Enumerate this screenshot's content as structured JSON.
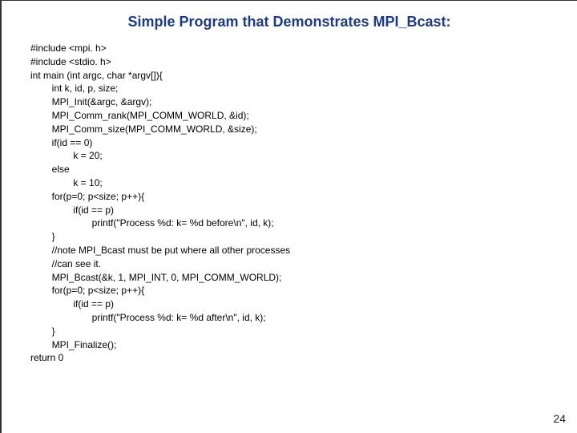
{
  "title": "Simple Program that Demonstrates MPI_Bcast:",
  "code": "#include <mpi. h>\n#include <stdio. h>\nint main (int argc, char *argv[]){\n        int k, id, p, size;\n        MPI_Init(&argc, &argv);\n        MPI_Comm_rank(MPI_COMM_WORLD, &id);\n        MPI_Comm_size(MPI_COMM_WORLD, &size);\n        if(id == 0)\n                k = 20;\n        else\n                k = 10;\n        for(p=0; p<size; p++){\n                if(id == p)\n                       printf(\"Process %d: k= %d before\\n\", id, k);\n        }\n        //note MPI_Bcast must be put where all other processes\n        //can see it.\n        MPI_Bcast(&k, 1, MPI_INT, 0, MPI_COMM_WORLD);\n        for(p=0; p<size; p++){\n                if(id == p)\n                       printf(\"Process %d: k= %d after\\n\", id, k);\n        }\n        MPI_Finalize();\nreturn 0",
  "page_number": "24"
}
